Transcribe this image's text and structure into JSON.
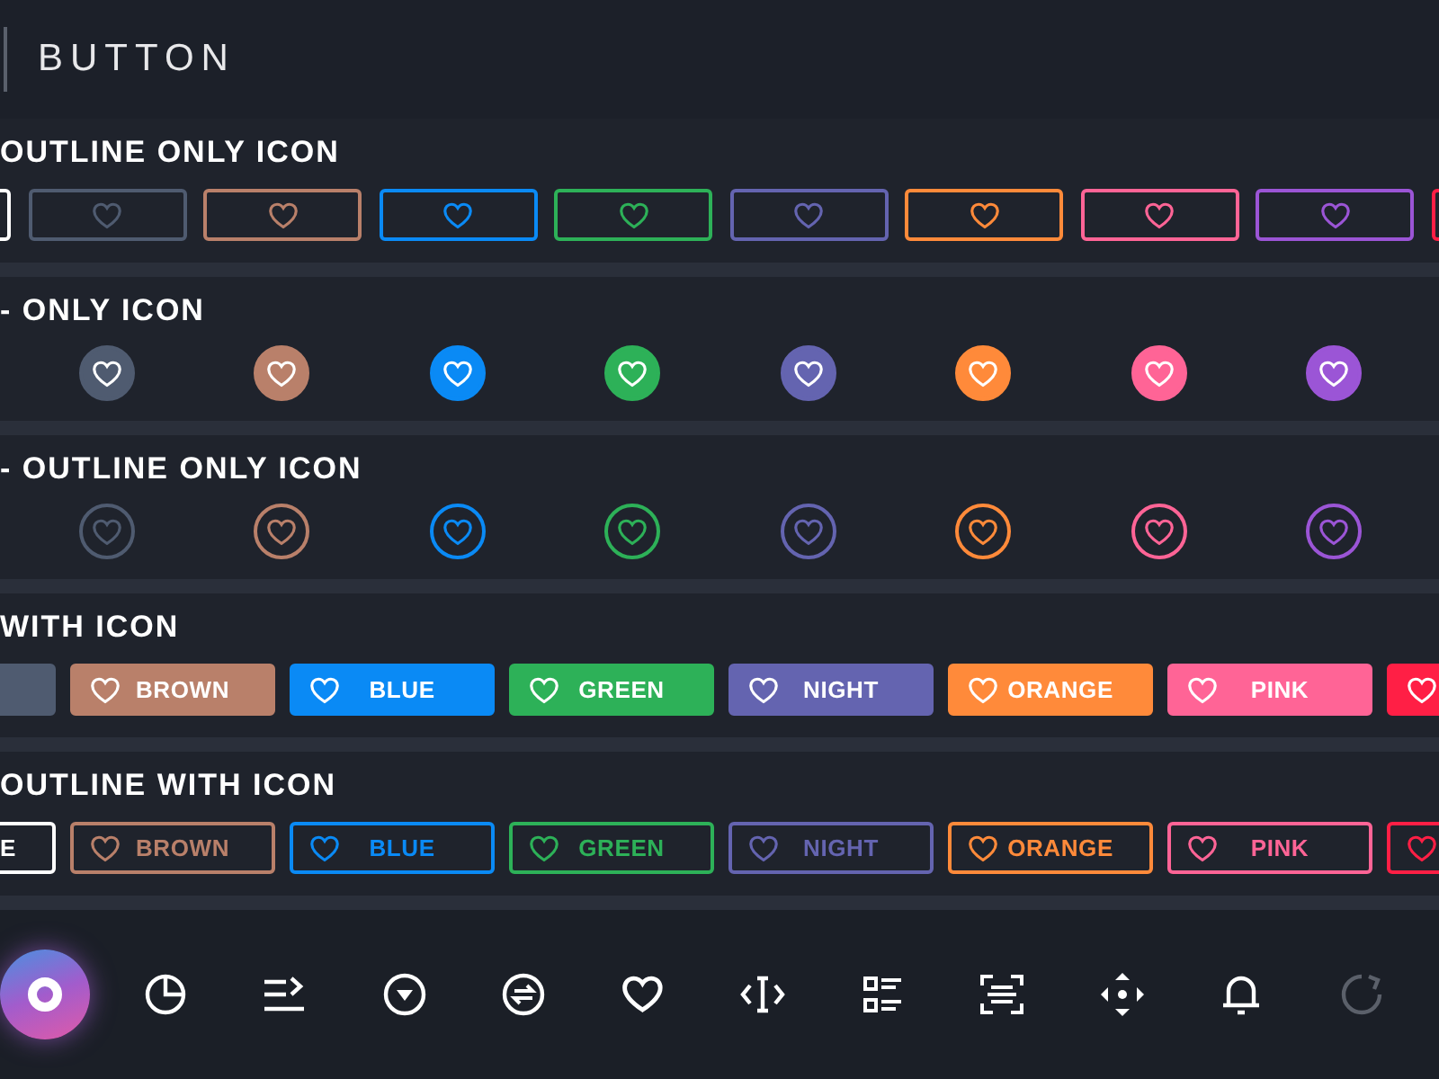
{
  "header": {
    "title": "BUTTON"
  },
  "sections": [
    {
      "title": "OUTLINE ONLY ICON",
      "kind": "outline-icon",
      "buttons": [
        {
          "color": "#ffffff"
        },
        {
          "color": "#4f5b70"
        },
        {
          "color": "#b9806a"
        },
        {
          "color": "#0a8af5"
        },
        {
          "color": "#2db158"
        },
        {
          "color": "#6464b0"
        },
        {
          "color": "#ff8a3a"
        },
        {
          "color": "#ff6496"
        },
        {
          "color": "#9b55d6"
        },
        {
          "color": "#ff1f45"
        }
      ]
    },
    {
      "title": "- ONLY ICON",
      "kind": "solid-circle",
      "buttons": [
        {
          "color": "#4f5b70"
        },
        {
          "color": "#b9806a"
        },
        {
          "color": "#0a8af5"
        },
        {
          "color": "#2db158"
        },
        {
          "color": "#6464b0"
        },
        {
          "color": "#ff8a3a"
        },
        {
          "color": "#ff6496"
        },
        {
          "color": "#9b55d6"
        }
      ]
    },
    {
      "title": "- OUTLINE ONLY ICON",
      "kind": "outline-circle",
      "buttons": [
        {
          "color": "#4f5b70"
        },
        {
          "color": "#b9806a"
        },
        {
          "color": "#0a8af5"
        },
        {
          "color": "#2db158"
        },
        {
          "color": "#6464b0"
        },
        {
          "color": "#ff8a3a"
        },
        {
          "color": "#ff6496"
        },
        {
          "color": "#9b55d6"
        }
      ]
    },
    {
      "title": "WITH ICON",
      "kind": "solid-label",
      "buttons": [
        {
          "color": "#4f5b70"
        },
        {
          "color": "#b9806a",
          "label": "BROWN"
        },
        {
          "color": "#0a8af5",
          "label": "BLUE"
        },
        {
          "color": "#2db158",
          "label": "GREEN"
        },
        {
          "color": "#6464b0",
          "label": "NIGHT"
        },
        {
          "color": "#ff8a3a",
          "label": "ORANGE"
        },
        {
          "color": "#ff6496",
          "label": "PINK"
        },
        {
          "color": "#ff1f45"
        }
      ]
    },
    {
      "title": "OUTLINE WITH ICON",
      "kind": "outline-label",
      "buttons": [
        {
          "color": "#ffffff",
          "label": "E"
        },
        {
          "color": "#b9806a",
          "label": "BROWN"
        },
        {
          "color": "#0a8af5",
          "label": "BLUE"
        },
        {
          "color": "#2db158",
          "label": "GREEN"
        },
        {
          "color": "#6464b0",
          "label": "NIGHT"
        },
        {
          "color": "#ff8a3a",
          "label": "ORANGE"
        },
        {
          "color": "#ff6496",
          "label": "PINK"
        },
        {
          "color": "#ff1f45"
        }
      ]
    }
  ],
  "toolbar": [
    {
      "selected": true,
      "disabled": false
    },
    {
      "selected": false,
      "disabled": false
    },
    {
      "selected": false,
      "disabled": false
    },
    {
      "selected": false,
      "disabled": false
    },
    {
      "selected": false,
      "disabled": false
    },
    {
      "selected": false,
      "disabled": false
    },
    {
      "selected": false,
      "disabled": false
    },
    {
      "selected": false,
      "disabled": false
    },
    {
      "selected": false,
      "disabled": false
    },
    {
      "selected": false,
      "disabled": false
    },
    {
      "selected": false,
      "disabled": false
    },
    {
      "selected": false,
      "disabled": true
    }
  ]
}
